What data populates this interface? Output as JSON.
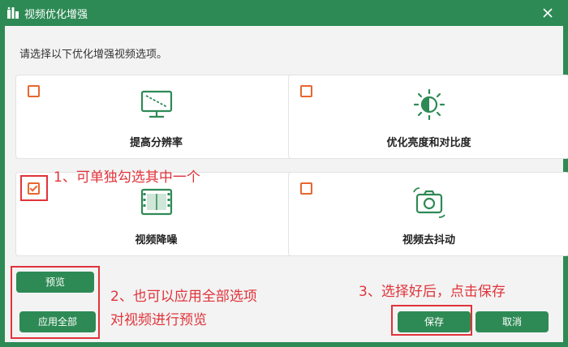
{
  "window": {
    "title": "视频优化增强",
    "title_icon": "app-logo-icon",
    "close_icon": "close-icon"
  },
  "instruction": "请选择以下优化增强视频选项。",
  "options": [
    {
      "label": "提高分辨率",
      "checked": false,
      "icon": "monitor-resolution-icon"
    },
    {
      "label": "优化亮度和对比度",
      "checked": false,
      "icon": "brightness-icon"
    },
    {
      "label": "视频降噪",
      "checked": true,
      "icon": "film-strip-icon"
    },
    {
      "label": "视频去抖动",
      "checked": false,
      "icon": "camera-stabilize-icon"
    }
  ],
  "buttons": {
    "preview": "预览",
    "apply_all": "应用全部",
    "save": "保存",
    "cancel": "取消"
  },
  "annotations": {
    "note1": "1、可单独勾选其中一个",
    "note2_line1": "2、也可以应用全部选项",
    "note2_line2": "对视频进行预览",
    "note3": "3、选择好后，点击保存"
  },
  "colors": {
    "brand_green": "#2e8a55",
    "checkbox_orange": "#e8662e",
    "annotation_red": "#e0333a"
  }
}
